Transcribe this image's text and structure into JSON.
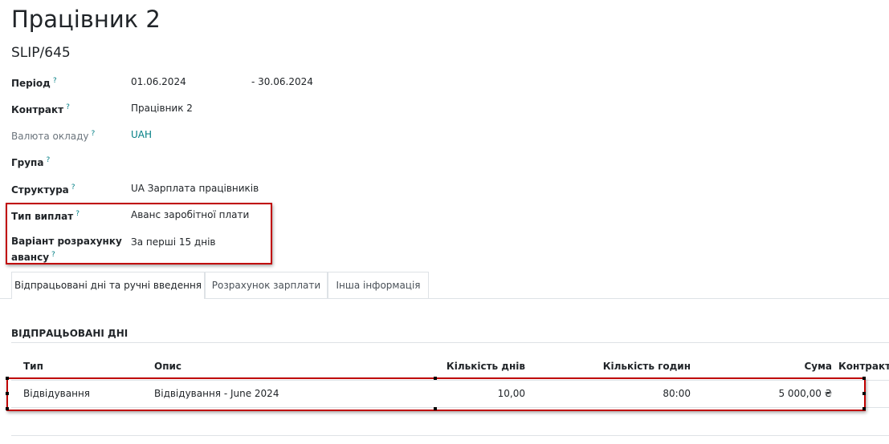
{
  "record": {
    "title": "Працівник 2",
    "reference": "SLIP/645"
  },
  "fields": {
    "period_label": "Період",
    "period_from": "01.06.2024",
    "period_to": "- 30.06.2024",
    "contract_label": "Контракт",
    "contract_value": "Працівник 2",
    "currency_label": "Валюта окладу",
    "currency_value": "UAH",
    "group_label": "Група",
    "structure_label": "Структура",
    "structure_value": "UA Зарплата працівників",
    "payment_type_label": "Тип виплат",
    "payment_type_value": "Аванс заробітної плати",
    "advance_variant_label_1": "Варіант розрахунку",
    "advance_variant_label_2": "авансу",
    "advance_variant_value": "За перші 15 днів",
    "help_mark": "?"
  },
  "tabs": [
    {
      "label": "Відпрацьовані дні та ручні введення",
      "active": true
    },
    {
      "label": "Розрахунок зарплати",
      "active": false
    },
    {
      "label": "Інша інформація",
      "active": false
    }
  ],
  "worked_days": {
    "section_title": "ВІДПРАЦЬОВАНІ ДНІ",
    "columns": [
      "Тип",
      "Опис",
      "Кількість днів",
      "Кількість годин",
      "Сума",
      "Контракт"
    ],
    "rows": [
      {
        "type": "Відвідування",
        "description": "Відвідування - June 2024",
        "days": "10,00",
        "hours": "80:00",
        "amount": "5 000,00 ₴",
        "contract": ""
      }
    ]
  },
  "colors": {
    "accent": "#017e84",
    "highlight": "#c00000"
  }
}
